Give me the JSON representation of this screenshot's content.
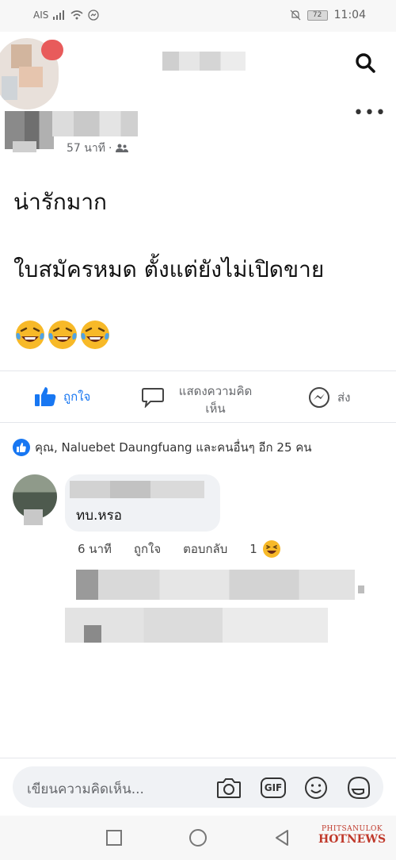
{
  "status_bar": {
    "carrier": "AIS",
    "battery": "72",
    "time": "11:04"
  },
  "post": {
    "time_ago": "57 นาที",
    "line1": "น่ารักมาก",
    "line2": "ใบสมัครหมด ตั้งแต่ยังไม่เปิดขาย",
    "emoji_count": 3
  },
  "actions": {
    "like": "ถูกใจ",
    "comment_line1": "แสดงความคิด",
    "comment_line2": "เห็น",
    "send": "ส่ง"
  },
  "reactions": {
    "summary": "คุณ, Naluebet Daungfuang และคนอื่นๆ อีก 25 คน"
  },
  "comment": {
    "text": "ทบ.หรอ",
    "time_ago": "6 นาที",
    "like": "ถูกใจ",
    "reply": "ตอบกลับ",
    "reaction_count": "1"
  },
  "composer": {
    "placeholder": "เขียนความคิดเห็น...",
    "gif_label": "GIF"
  },
  "watermark": {
    "line1": "PHITSANULOK",
    "line2": "HOTNEWS"
  },
  "colors": {
    "accent": "#1877f2",
    "notification": "#e85b5b",
    "emoji_yellow": "#f7b928",
    "watermark": "#c0392b"
  }
}
